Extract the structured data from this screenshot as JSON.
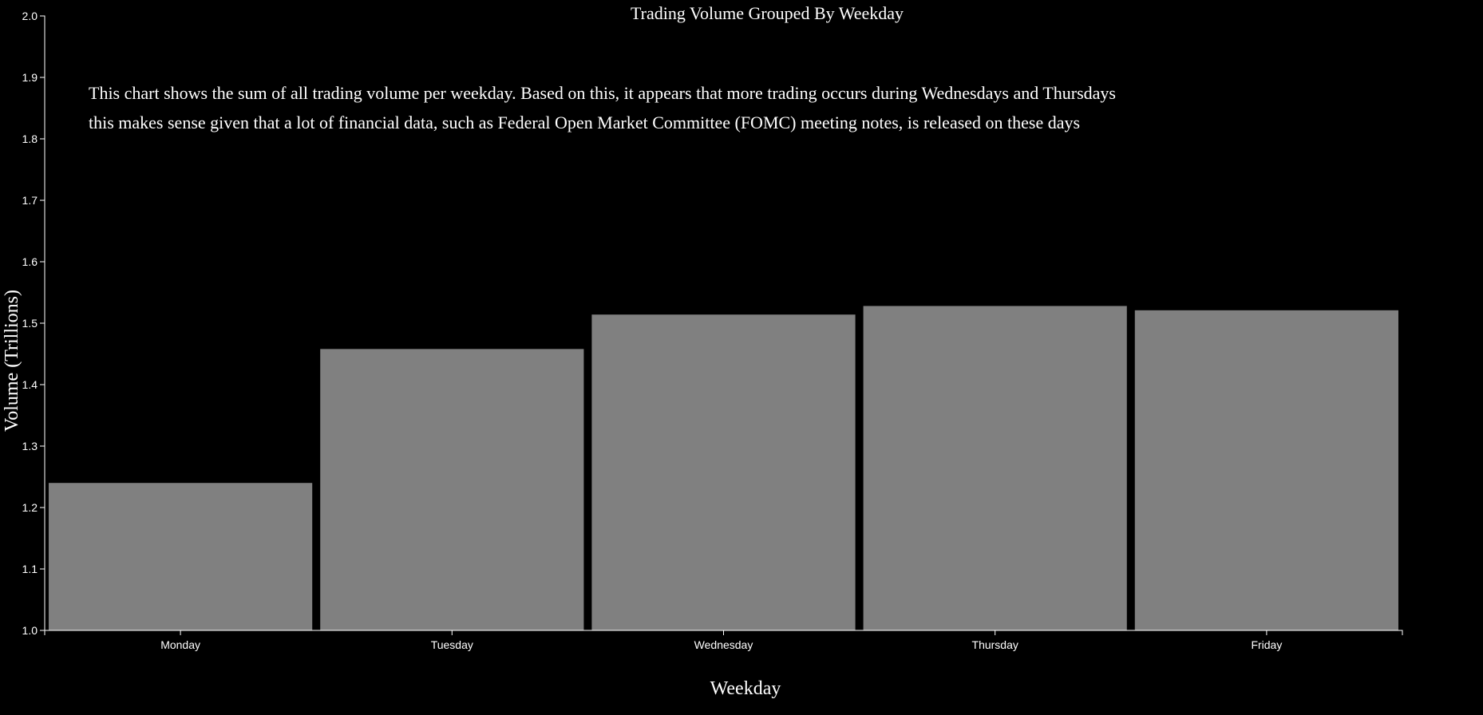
{
  "chart_data": {
    "type": "bar",
    "title": "Trading Volume Grouped By Weekday",
    "xlabel": "Weekday",
    "ylabel": "Volume (Trillions)",
    "categories": [
      "Monday",
      "Tuesday",
      "Wednesday",
      "Thursday",
      "Friday"
    ],
    "values": [
      1.24,
      1.458,
      1.514,
      1.528,
      1.521
    ],
    "ylim": [
      1.0,
      2.0
    ],
    "yticks": [
      "1.0",
      "1.1",
      "1.2",
      "1.3",
      "1.4",
      "1.5",
      "1.6",
      "1.7",
      "1.8",
      "1.9",
      "2.0"
    ],
    "grid": false,
    "bar_color": "#808080",
    "background_color": "#000000",
    "text_color": "#ffffff",
    "annotation": [
      "This chart shows the sum of all trading volume per weekday. Based on this, it appears that more trading occurs during Wednesdays and Thursdays",
      "this makes sense given that a lot of financial data, such as Federal Open Market Committee (FOMC) meeting notes, is released on these days"
    ]
  }
}
